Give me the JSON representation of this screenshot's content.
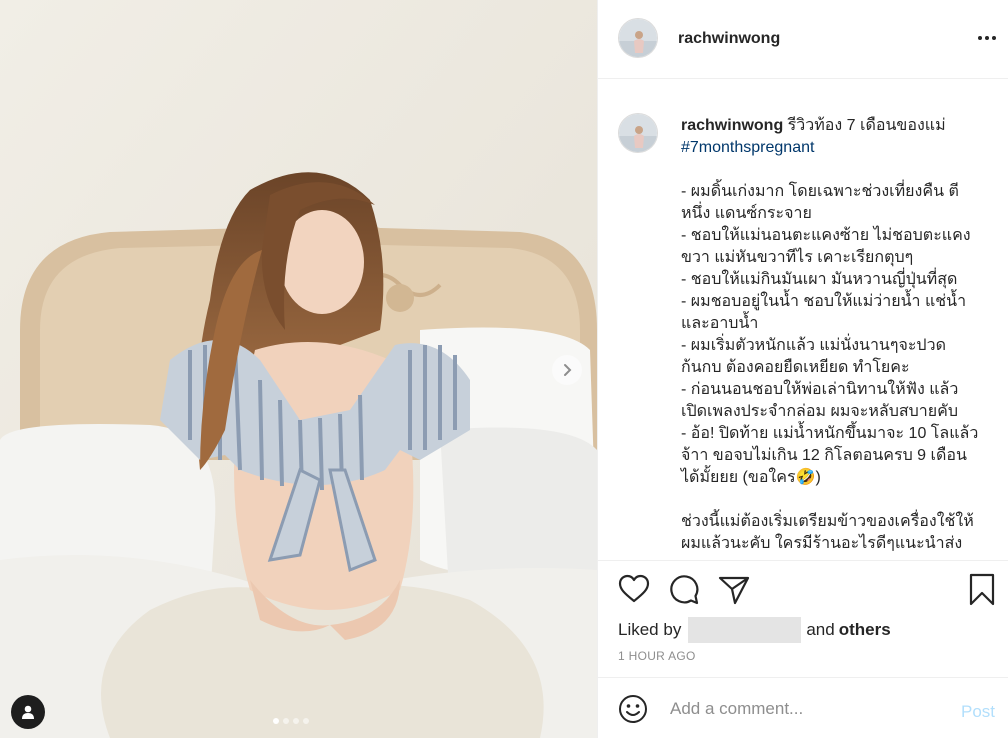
{
  "post": {
    "username": "rachwinwong",
    "more_icon": "ellipsis-icon"
  },
  "caption": {
    "username": "rachwinwong",
    "headline": " รีวิวท้อง 7 เดือนของแม่",
    "hashtag": "#7monthspregnant",
    "lines": [
      "- ผมดิ้นเก่งมาก โดยเฉพาะช่วงเที่ยงคืน ตีหนึ่ง แดนซ์กระจาย",
      "- ชอบให้แม่นอนตะแคงซ้าย ไม่ชอบตะแคงขวา แม่หันขวาทีไร เคาะเรียกตุบๆ",
      "- ชอบให้แม่กินมันเผา มันหวานญี่ปุ่นที่สุด",
      "- ผมชอบอยู่ในน้ำ ชอบให้แม่ว่ายน้ำ แช่น้ำ และอาบน้ำ",
      "- ผมเริ่มตัวหนักแล้ว แม่นั่งนานๆจะปวดก้นกบ ต้องคอยยืดเหยียด ทำโยคะ",
      "- ก่อนนอนชอบให้พ่อเล่านิทานให้ฟัง แล้วเปิดเพลงประจำกล่อม ผมจะหลับสบายคับ",
      "- อ้อ! ปิดท้าย แม่น้ำหนักขึ้นมาจะ 10 โลแล้วจ้าา ขอจบไม่เกิน 12 กิโลตอนครบ 9 เดือนได้มั้ยยย (ขอใคร🤣)",
      "",
      "ช่วงนี้แม่ต้องเริ่มเตรียมข้าวของเครื่องใช้ให้ผมแล้วนะคับ ใครมีร้านอะไรดีๆแนะนำส่ง"
    ]
  },
  "engagement": {
    "liked_prefix": "Liked by",
    "and_text": "and",
    "others_text": "others",
    "timestamp": "1 HOUR AGO"
  },
  "comment": {
    "placeholder": "Add a comment...",
    "post_label": "Post"
  },
  "carousel": {
    "slide_count": 4,
    "active_slide": 1
  },
  "colors": {
    "link": "#00376b",
    "post_disabled": "#b2dffc",
    "muted": "#8e8e8e"
  }
}
